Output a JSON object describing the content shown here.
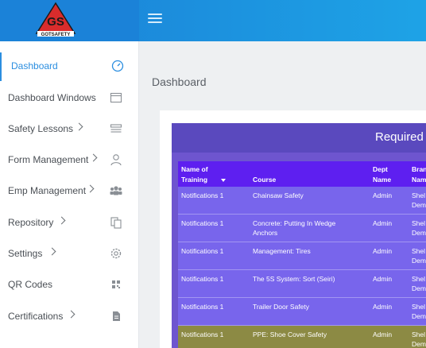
{
  "header": {
    "logo_text": "GS",
    "logo_name": "GOTSAFETY"
  },
  "sidebar": {
    "items": [
      {
        "label": "Dashboard",
        "active": true,
        "icon": "speedometer-icon"
      },
      {
        "label": "Dashboard Windows",
        "icon": "window-icon"
      },
      {
        "label": "Safety Lessons",
        "chevron": true,
        "icon": "layers-icon"
      },
      {
        "label": "Form Management",
        "chevron": true,
        "icon": "user-icon"
      },
      {
        "label": "Emp Management",
        "chevron": true,
        "icon": "users-icon"
      },
      {
        "label": "Repository",
        "chevron": true,
        "icon": "documents-icon"
      },
      {
        "label": "Settings",
        "chevron": true,
        "icon": "gear-icon"
      },
      {
        "label": "QR Codes",
        "icon": "qr-code-icon"
      },
      {
        "label": "Certifications",
        "chevron": true,
        "icon": "certificate-icon"
      }
    ]
  },
  "main": {
    "page_title": "Dashboard",
    "table": {
      "title": "Required T",
      "columns": [
        "Name of Training",
        "Course",
        "Dept Name",
        "Bran Nam"
      ],
      "rows": [
        {
          "name": "Notifications 1",
          "course": "Chainsaw Safety",
          "dept": "Admin",
          "branch": "Shel Dem"
        },
        {
          "name": "Notifications 1",
          "course": "Concrete: Putting In Wedge Anchors",
          "dept": "Admin",
          "branch": "Shel Dem"
        },
        {
          "name": "Notifications 1",
          "course": "Management: Tires",
          "dept": "Admin",
          "branch": "Shel Dem"
        },
        {
          "name": "Notifications 1",
          "course": "The 5S System: Sort (Seiri)",
          "dept": "Admin",
          "branch": "Shel Dem"
        },
        {
          "name": "Notifications 1",
          "course": "Trailer Door Safety",
          "dept": "Admin",
          "branch": "Shel Dem"
        },
        {
          "name": "Notifications 1",
          "course": "PPE: Shoe Cover Safety",
          "dept": "Admin",
          "branch": "Shel Dem",
          "highlight": true
        }
      ]
    }
  },
  "colors": {
    "topbar": "#1a7fd6",
    "accent": "#2b8ee0",
    "table_bg": "#6e55cf",
    "table_head": "#5e1ff0",
    "row_highlight": "#8c8a44"
  }
}
